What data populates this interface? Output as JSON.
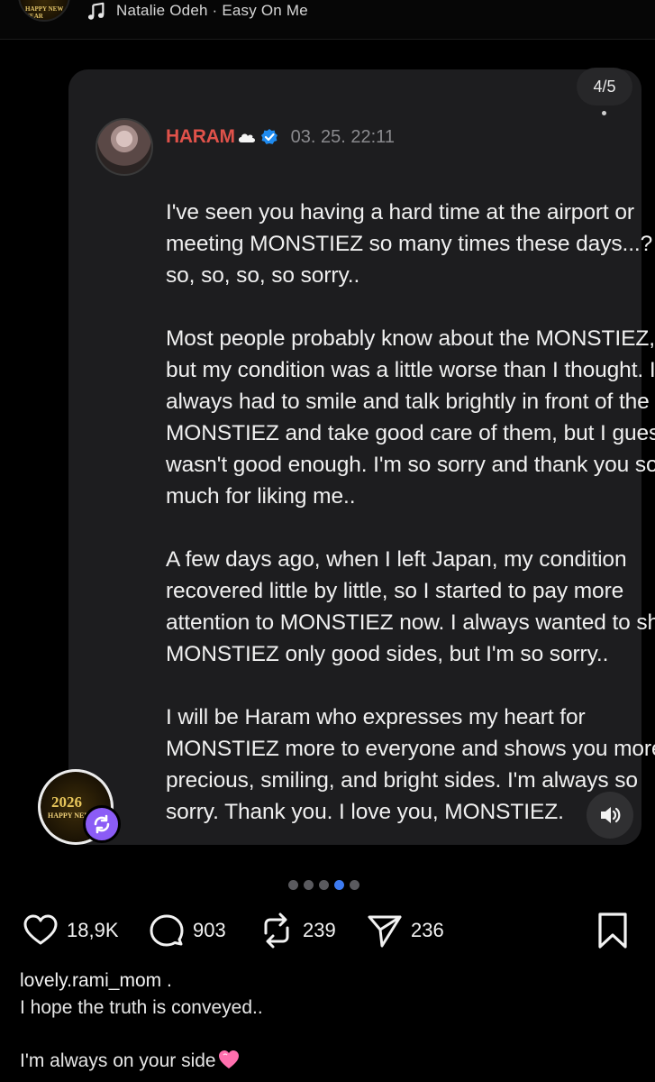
{
  "music": {
    "artist_track": "Natalie Odeh · Easy On Me",
    "icon": "music-note-icon"
  },
  "post": {
    "handle": "HARAM",
    "timestamp": "03. 25. 22:11",
    "paragraphs": [
      "I've seen you having a hard time at the airport or meeting MONSTIEZ so many times these days...? I'm so, so, so, so sorry..",
      "Most people probably know about the MONSTIEZ, but my condition was a little worse than I thought. I always had to smile and talk brightly in front of the MONSTIEZ and take good care of them, but I guess I wasn't good enough. I'm so sorry and thank you so much for liking me..",
      "A few days ago, when I left Japan, my condition recovered little by little, so I started to pay more attention to MONSTIEZ now. I always wanted to show MONSTIEZ only good sides, but I'm so sorry..",
      "I will be Haram who expresses my heart for MONSTIEZ more to everyone and shows you more precious, smiling, and bright sides. I'm always so sorry. Thank you. I love you, MONSTIEZ."
    ]
  },
  "carousel": {
    "counter": "4/5",
    "current": 4,
    "total": 5
  },
  "story_badge": {
    "year": "2026",
    "text": "HAPPY NEW"
  },
  "actions": {
    "likes": "18,9K",
    "comments": "903",
    "reposts": "239",
    "shares": "236"
  },
  "caption": {
    "username": "lovely.rami_mom",
    "suffix": " .",
    "line1": "I hope the truth is conveyed..",
    "line2": "I'm always on your side"
  },
  "colors": {
    "accent": "#3d7bf2",
    "handle": "#e0524a",
    "badge": "#8b5cf6",
    "heart_emoji": "#ff6fae"
  }
}
